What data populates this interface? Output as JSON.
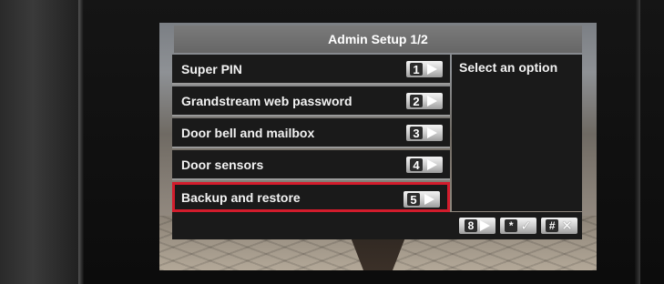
{
  "screen": {
    "title": "Admin Setup 1/2",
    "menu_items": [
      {
        "label": "Super PIN",
        "key": "1"
      },
      {
        "label": "Grandstream web password",
        "key": "2"
      },
      {
        "label": "Door bell and mailbox",
        "key": "3"
      },
      {
        "label": "Door sensors",
        "key": "4"
      },
      {
        "label": "Backup and restore",
        "key": "5"
      }
    ],
    "selected_index": 4,
    "hint": "Select an option",
    "footer_keys": [
      {
        "key": "8",
        "icon": "next-arrow-icon"
      },
      {
        "key": "*",
        "icon": "checkmark-icon"
      },
      {
        "key": "#",
        "icon": "close-icon"
      }
    ]
  },
  "colors": {
    "selection_border": "#d21c2c",
    "title_bar": "#707070",
    "panel_bg": "#1a1a1a"
  }
}
